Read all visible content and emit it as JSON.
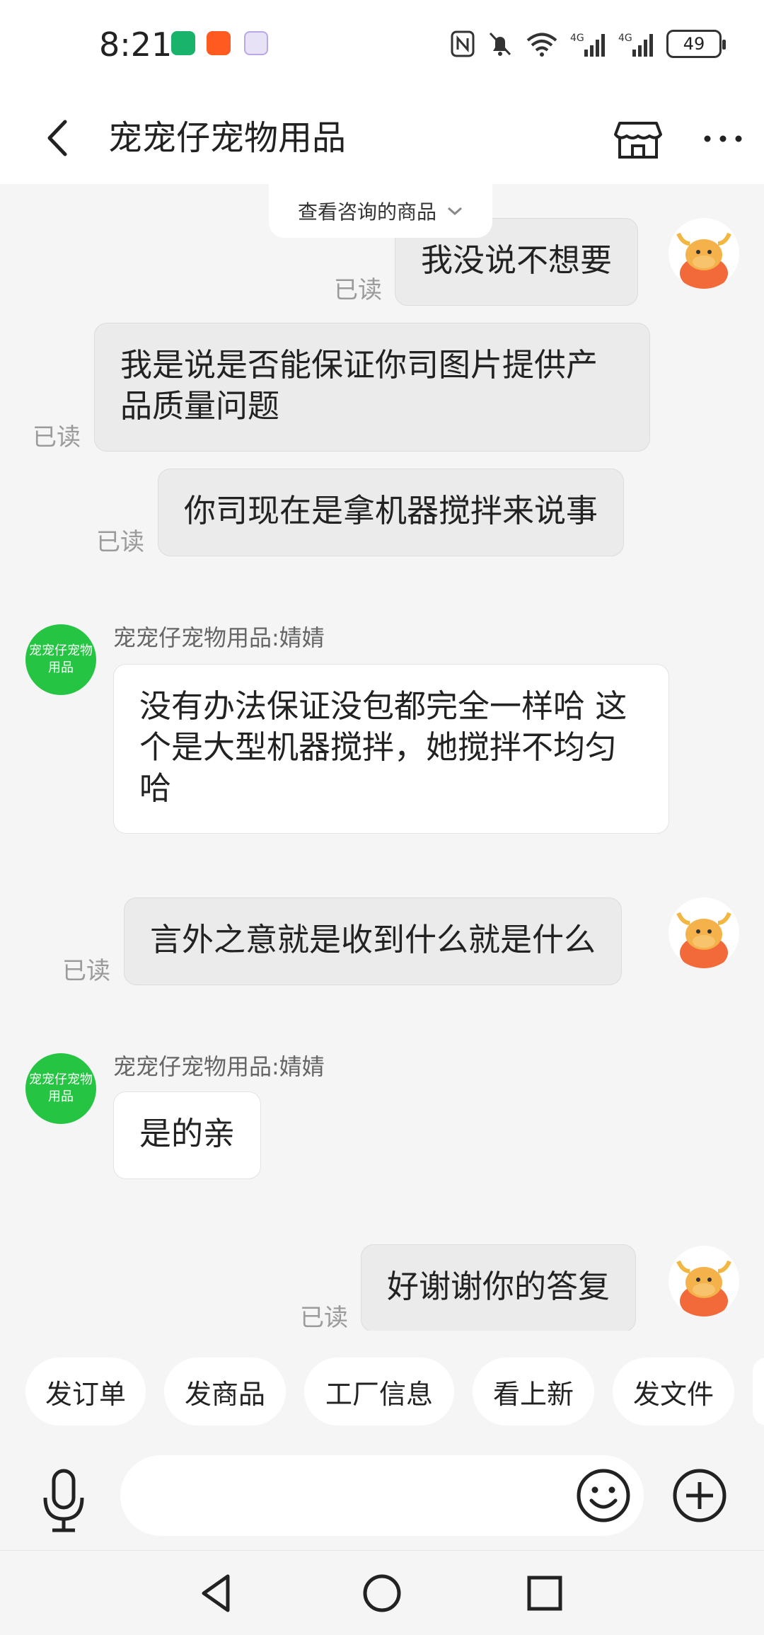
{
  "status_bar": {
    "time": "8:21",
    "battery": "49",
    "icons": [
      "nfc-icon",
      "silent-bell-icon",
      "wifi-icon",
      "4g-signal-icon",
      "4g-signal-icon",
      "battery-icon"
    ]
  },
  "header": {
    "title": "宠宠仔宠物用品",
    "icons": [
      "back-arrow-icon",
      "store-icon",
      "more-icon"
    ]
  },
  "chat": {
    "product_tab": "查看咨询的商品",
    "read_label": "已读",
    "shop_avatar_text": "宠宠仔宠物用品",
    "messages": [
      {
        "side": "mine",
        "text": "我没说不想要",
        "status": "已读"
      },
      {
        "side": "mine",
        "text": "我是说是否能保证你司图片提供产品质量问题",
        "status": "已读"
      },
      {
        "side": "mine",
        "text": "你司现在是拿机器搅拌来说事",
        "status": "已读"
      },
      {
        "side": "theirs",
        "sender": "宠宠仔宠物用品:婧婧",
        "text": "没有办法保证没包都完全一样哈 这个是大型机器搅拌，她搅拌不均匀哈"
      },
      {
        "side": "mine",
        "text": "言外之意就是收到什么就是什么",
        "status": "已读"
      },
      {
        "side": "theirs",
        "sender": "宠宠仔宠物用品:婧婧",
        "text": "是的亲"
      },
      {
        "side": "mine",
        "text": "好谢谢你的答复",
        "status": "已读"
      }
    ]
  },
  "quick_actions": [
    "发订单",
    "发商品",
    "工厂信息",
    "看上新",
    "发文件"
  ],
  "input": {
    "placeholder": ""
  },
  "colors": {
    "shop_avatar": "#25c442",
    "user_avatar": "#f26a3a",
    "mine_bubble": "#ebebeb",
    "read_text": "#9b9b9b"
  }
}
